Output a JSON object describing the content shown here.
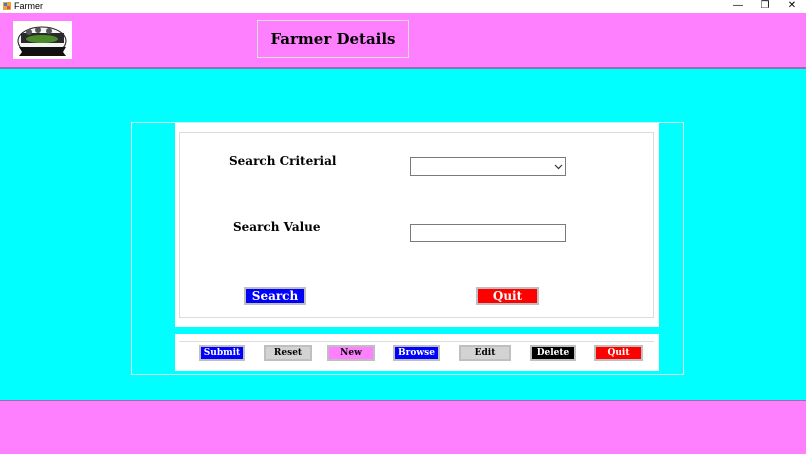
{
  "window": {
    "title": "Farmer",
    "minimize_glyph": "—",
    "restore_glyph": "❐",
    "close_glyph": "✕"
  },
  "header": {
    "title": "Farmer Details",
    "background": "#FF80FF"
  },
  "search": {
    "criteria_label": "Search Criterial",
    "criteria_selected": "",
    "value_label": "Search Value",
    "value_text": "",
    "search_button": "Search",
    "quit_button": "Quit"
  },
  "actions": {
    "submit": "Submit",
    "reset": "Reset",
    "new": "New",
    "browse": "Browse",
    "edit": "Edit",
    "delete": "Delete",
    "quit": "Quit"
  },
  "colors": {
    "page_background": "#00FFFF",
    "blue_button": "#0000FF",
    "red_button": "#FF0000",
    "gray_button": "#D3D3D3",
    "pink_button": "#FF80FF",
    "black_button": "#000000"
  }
}
